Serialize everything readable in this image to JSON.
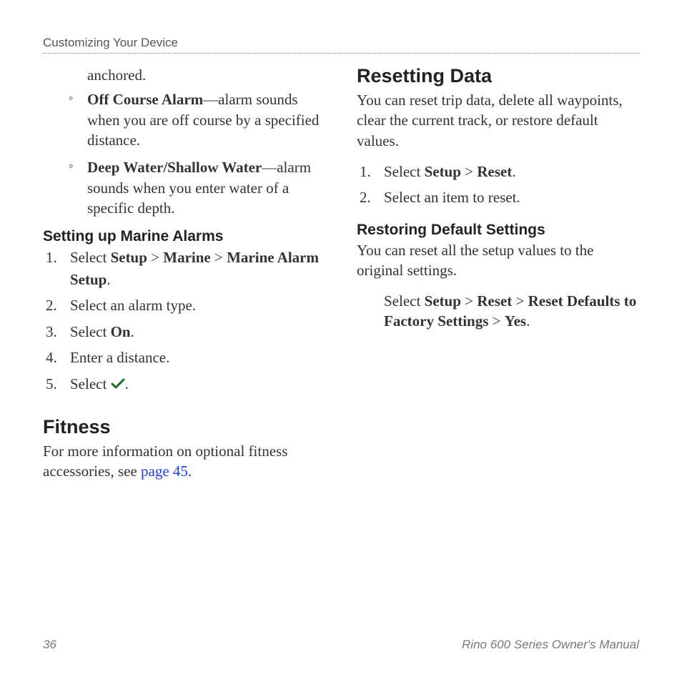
{
  "header": {
    "section": "Customizing Your Device"
  },
  "left": {
    "continuation": "anchored.",
    "bullets": [
      {
        "term": "Off Course Alarm",
        "rest": "—alarm sounds when you are off course by a specified distance."
      },
      {
        "term": "Deep Water/Shallow Water",
        "rest": "—alarm sounds when you enter water of a specific depth."
      }
    ],
    "marine_heading": "Setting up Marine Alarms",
    "marine_steps": {
      "s1_pre": "Select ",
      "s1_b1": "Setup",
      "s1_gt1": " > ",
      "s1_b2": "Marine",
      "s1_gt2": " > ",
      "s1_b3": "Marine Alarm Setup",
      "s1_post": ".",
      "s2": "Select an alarm type.",
      "s3_pre": "Select ",
      "s3_b": "On",
      "s3_post": ".",
      "s4": "Enter a distance.",
      "s5_pre": "Select ",
      "s5_post": "."
    },
    "fitness_heading": "Fitness",
    "fitness_text_pre": "For more information on optional fitness accessories, see ",
    "fitness_link": "page 45",
    "fitness_text_post": "."
  },
  "right": {
    "reset_heading": "Resetting Data",
    "reset_intro": "You can reset trip data, delete all waypoints, clear the current track, or restore default values.",
    "reset_steps": {
      "s1_pre": "Select ",
      "s1_b1": "Setup",
      "s1_gt": " > ",
      "s1_b2": "Reset",
      "s1_post": ".",
      "s2": "Select an item to reset."
    },
    "restore_heading": "Restoring Default Settings",
    "restore_intro": "You can reset all the setup values to the original settings.",
    "restore_block": {
      "pre": "Select ",
      "b1": "Setup",
      "gt1": " > ",
      "b2": "Reset",
      "gt2": " > ",
      "b3": "Reset Defaults to Factory Settings",
      "gt3": " > ",
      "b4": "Yes",
      "post": "."
    }
  },
  "footer": {
    "page": "36",
    "manual": "Rino 600 Series Owner's Manual"
  }
}
